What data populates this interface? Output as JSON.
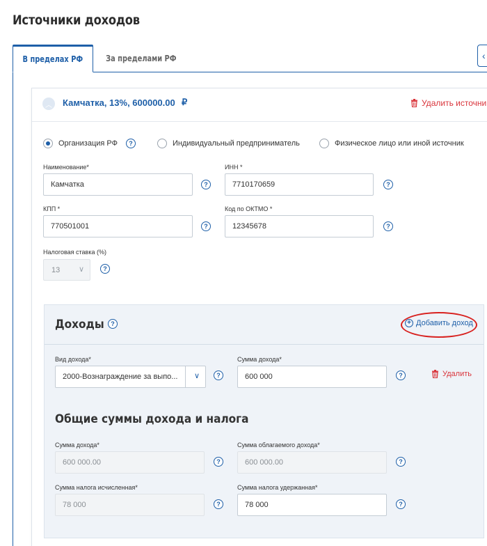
{
  "page": {
    "title": "Источники доходов"
  },
  "tabs": [
    {
      "label": "В пределах РФ",
      "active": true
    },
    {
      "label": "За пределами РФ",
      "active": false
    }
  ],
  "source": {
    "title": "Камчатка, 13%, 600000.00",
    "currency": "₽",
    "delete_label": "Удалить источник",
    "source_types": [
      {
        "label": "Организация РФ",
        "selected": true
      },
      {
        "label": "Индивидуальный предприниматель",
        "selected": false
      },
      {
        "label": "Физическое лицо или иной источник",
        "selected": false
      }
    ],
    "name": {
      "label": "Наименование*",
      "value": "Камчатка"
    },
    "inn": {
      "label": "ИНН *",
      "value": "7710170659"
    },
    "kpp": {
      "label": "КПП *",
      "value": "770501001"
    },
    "oktmo": {
      "label": "Код по ОКТМО *",
      "value": "12345678"
    },
    "tax_rate": {
      "label": "Налоговая ставка (%)",
      "value": "13"
    }
  },
  "incomes": {
    "title": "Доходы",
    "add_label": "Добавить доход",
    "item": {
      "type_label": "Вид дохода*",
      "type_value": "2000-Вознаграждение за выпо...",
      "amount_label": "Сумма дохода*",
      "amount_value": "600 000",
      "delete_label": "Удалить"
    }
  },
  "totals": {
    "title": "Общие суммы дохода и налога",
    "income_sum": {
      "label": "Сумма дохода*",
      "value": "600 000.00"
    },
    "taxable_sum": {
      "label": "Сумма облагаемого дохода*",
      "value": "600 000.00"
    },
    "tax_calculated": {
      "label": "Сумма налога исчисленная*",
      "value": "78 000"
    },
    "tax_withheld": {
      "label": "Сумма налога удержанная*",
      "value": "78 000"
    }
  },
  "icons": {
    "help": "?",
    "chevron_up": "︿",
    "chevron_down": "∨",
    "collapse": "‹",
    "trash": "trash-icon",
    "plus_circle": "plus-circle-icon"
  },
  "colors": {
    "accent": "#1e5fa8",
    "danger": "#d9343b",
    "annotation": "#d8201e"
  }
}
